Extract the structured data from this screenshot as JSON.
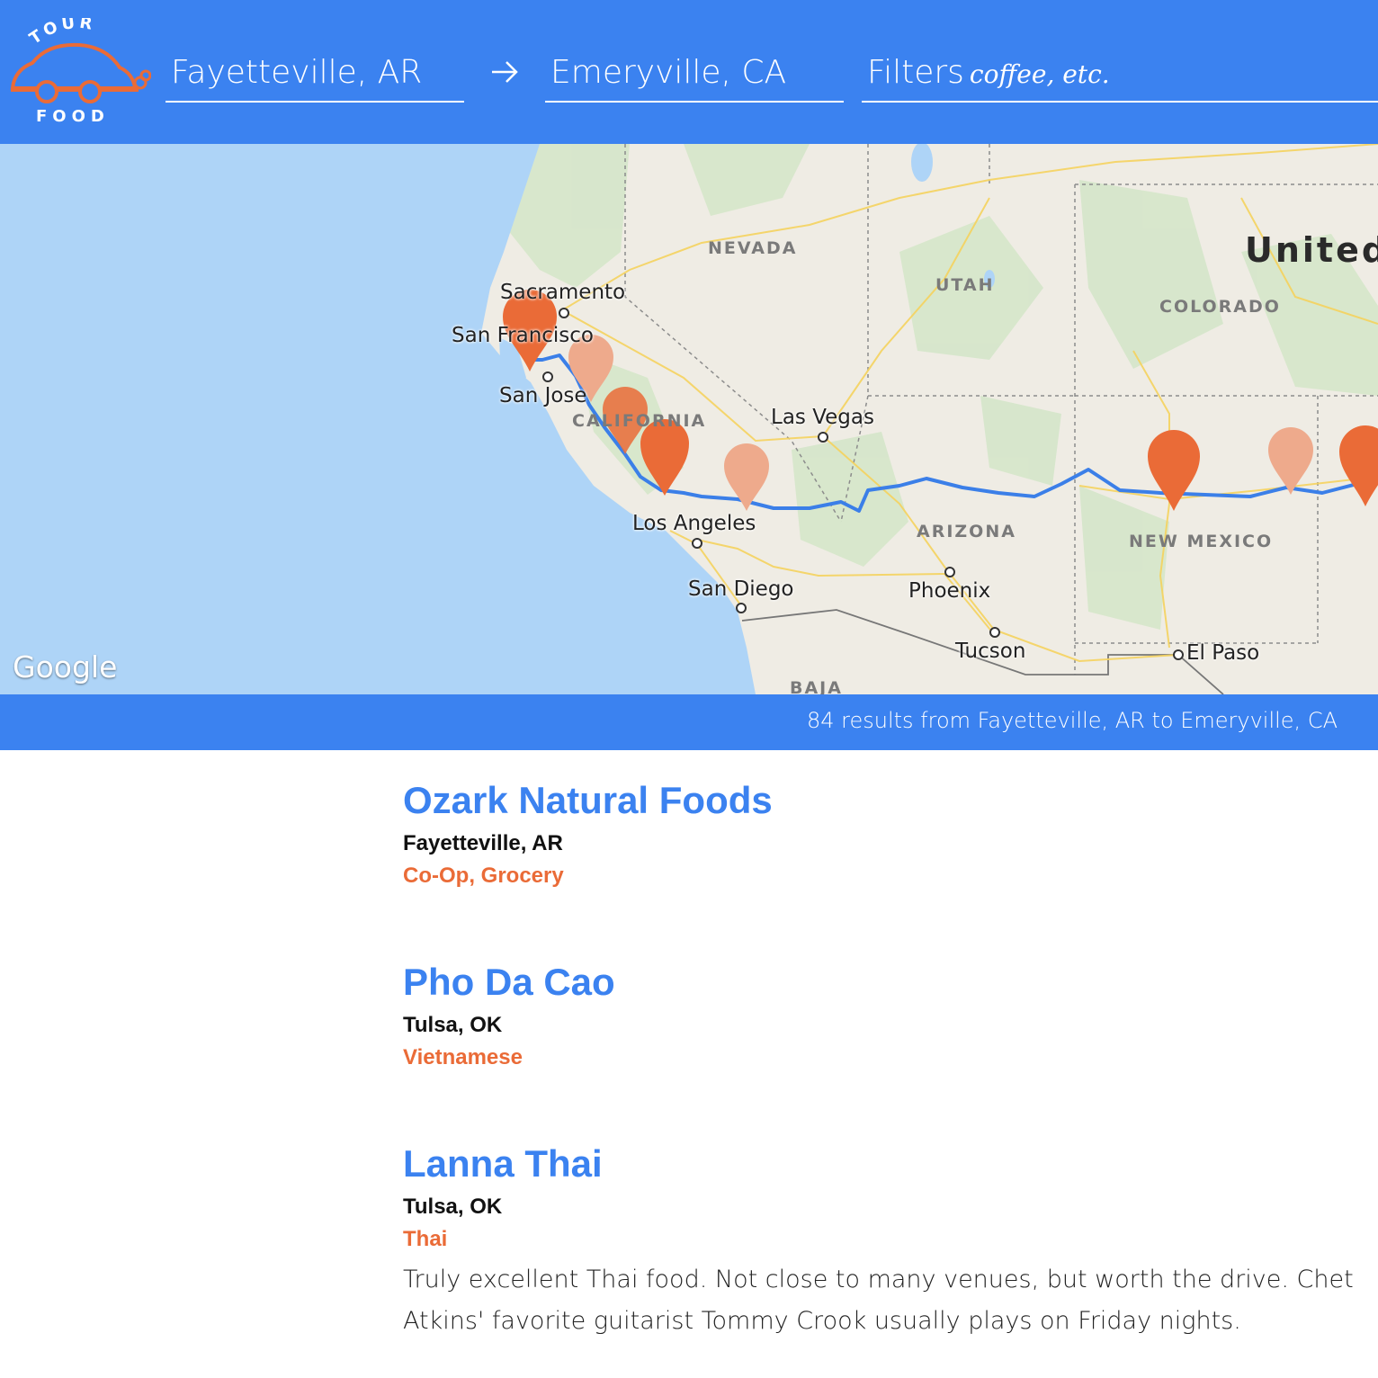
{
  "app": {
    "logo_text_top": "TOUR",
    "logo_text_bottom": "FOOD"
  },
  "search": {
    "from_value": "Fayetteville, AR",
    "to_value": "Emeryville, CA",
    "filters_label": "Filters",
    "filters_placeholder": "coffee, etc."
  },
  "map": {
    "country_label": "United",
    "state_labels": [
      "NEVADA",
      "UTAH",
      "COLORADO",
      "CALIFORNIA",
      "ARIZONA",
      "NEW MEXICO",
      "BAJA"
    ],
    "city_labels": [
      "Sacramento",
      "San Francisco",
      "San Jose",
      "Las Vegas",
      "Los Angeles",
      "San Diego",
      "Phoenix",
      "Tucson",
      "El Paso"
    ],
    "attribution": "Google",
    "colors": {
      "water": "#aed4f7",
      "land": "#efece4",
      "route": "#3b7fe8",
      "marker_active": "#ea6b37",
      "marker_inactive": "#eeaa8c"
    }
  },
  "results": {
    "summary": "84 results from Fayetteville, AR to Emeryville, CA"
  },
  "listings": [
    {
      "name": "Ozark Natural Foods",
      "city": "Fayetteville, AR",
      "tags": "Co-Op, Grocery",
      "description": ""
    },
    {
      "name": "Pho Da Cao",
      "city": "Tulsa, OK",
      "tags": "Vietnamese",
      "description": ""
    },
    {
      "name": "Lanna Thai",
      "city": "Tulsa, OK",
      "tags": "Thai",
      "description": "Truly excellent Thai food. Not close to many venues, but worth the drive. Chet Atkins' favorite guitarist Tommy Crook usually plays on Friday nights."
    }
  ],
  "theme": {
    "brand_blue": "#3b82f0",
    "accent_orange": "#ea6b37"
  }
}
